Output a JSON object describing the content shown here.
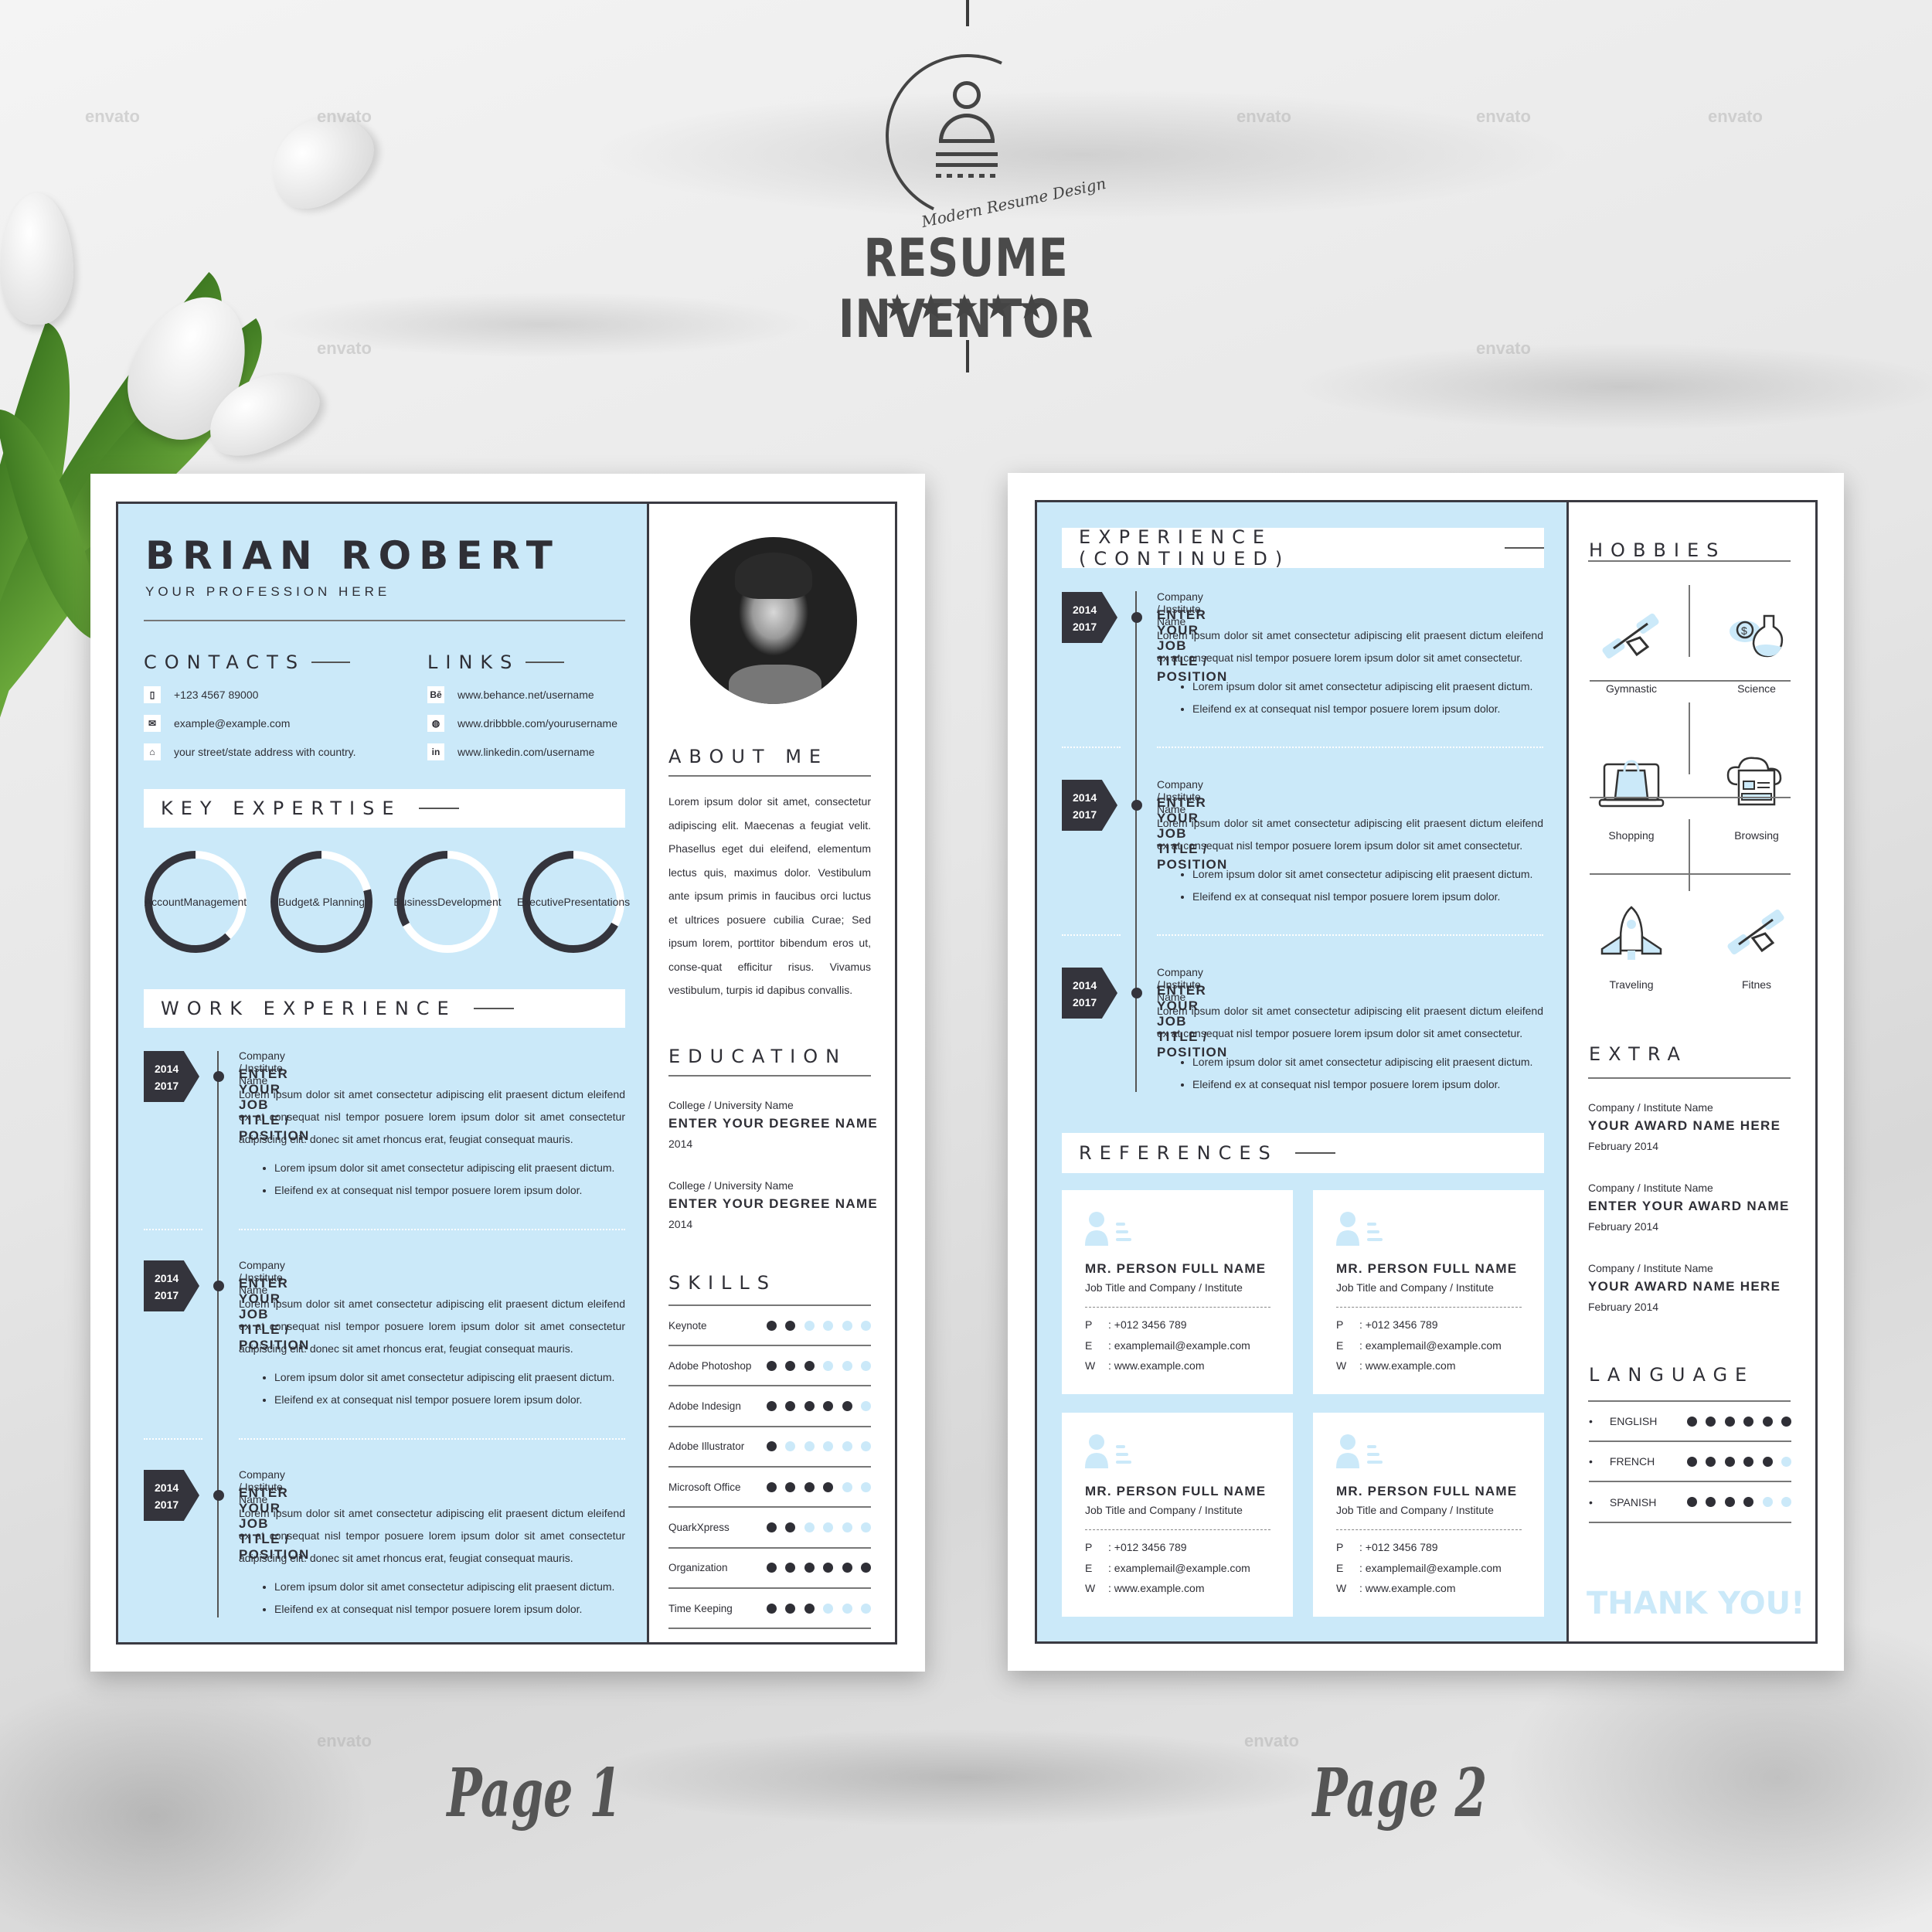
{
  "brand": {
    "logo_tagline": "Modern Resume Design",
    "title": "RESUME INVENTOR",
    "stars": "★★★★★",
    "rating": 5,
    "watermark": "envato"
  },
  "captions": {
    "page1": "Page 1",
    "page2": "Page 2"
  },
  "colors": {
    "accent": "#cbe9f9",
    "dark": "#34343c",
    "text": "#2f2f36"
  },
  "page1": {
    "name": "BRIAN ROBERT",
    "profession": "YOUR PROFESSION HERE",
    "contacts": {
      "heading": "CONTACTS",
      "items": [
        {
          "icon": "phone-icon",
          "glyph": "▯",
          "text": "+123 4567 89000"
        },
        {
          "icon": "envelope-icon",
          "glyph": "✉",
          "text": "example@example.com"
        },
        {
          "icon": "home-icon",
          "glyph": "⌂",
          "text": "your street/state address with country."
        }
      ]
    },
    "links": {
      "heading": "LINKS",
      "items": [
        {
          "icon": "behance-icon",
          "glyph": "Bē",
          "text": "www.behance.net/username"
        },
        {
          "icon": "dribbble-icon",
          "glyph": "◍",
          "text": "www.dribbble.com/yourusername"
        },
        {
          "icon": "linkedin-icon",
          "glyph": "in",
          "text": "www.linkedin.com/username"
        }
      ]
    },
    "key_expertise": {
      "heading": "KEY EXPERTISE",
      "items": [
        {
          "line1": "Account",
          "line2": "Management",
          "percent": 62
        },
        {
          "line1": "Budget",
          "line2": "& Planning",
          "percent": 79
        },
        {
          "line1": "Business",
          "line2": "Development",
          "percent": 33
        },
        {
          "line1": "Executive",
          "line2": "Presentations",
          "percent": 67
        }
      ]
    },
    "work_experience": {
      "heading": "WORK EXPERIENCE",
      "jobs": [
        {
          "start": "2014",
          "end": "2017",
          "company": "Company / Institute Name",
          "title": "ENTER YOUR JOB TITLE / POSITION",
          "description": "Lorem ipsum dolor sit amet consectetur adipiscing elit praesent dictum eleifend ex at consequat nisl tempor posuere lorem ipsum dolor sit amet consectetur adipiscing elit. donec sit amet rhoncus erat, feugiat consequat mauris.",
          "bullets": [
            "Lorem ipsum dolor sit amet consectetur adipiscing elit praesent dictum.",
            "Eleifend ex at consequat nisl tempor posuere lorem ipsum dolor."
          ]
        },
        {
          "start": "2014",
          "end": "2017",
          "company": "Company / Institute Name",
          "title": "ENTER YOUR JOB TITLE / POSITION",
          "description": "Lorem ipsum dolor sit amet consectetur adipiscing elit praesent dictum eleifend ex at consequat nisl tempor posuere lorem ipsum dolor sit amet consectetur adipiscing elit. donec sit amet rhoncus erat, feugiat consequat mauris.",
          "bullets": [
            "Lorem ipsum dolor sit amet consectetur adipiscing elit praesent dictum.",
            "Eleifend ex at consequat nisl tempor posuere lorem ipsum dolor."
          ]
        },
        {
          "start": "2014",
          "end": "2017",
          "company": "Company / Institute Name",
          "title": "ENTER YOUR JOB TITLE / POSITION",
          "description": "Lorem ipsum dolor sit amet consectetur adipiscing elit praesent dictum eleifend ex at consequat nisl tempor posuere lorem ipsum dolor sit amet consectetur adipiscing elit. donec sit amet rhoncus erat, feugiat consequat mauris.",
          "bullets": [
            "Lorem ipsum dolor sit amet consectetur adipiscing elit praesent dictum.",
            "Eleifend ex at consequat nisl tempor posuere lorem ipsum dolor."
          ]
        }
      ]
    },
    "about": {
      "heading": "ABOUT ME",
      "text": "Lorem ipsum dolor sit amet, consectetur adipiscing elit. Maecenas a feugiat velit. Phasellus eget dui eleifend, elementum lectus quis, maximus dolor. Vestibulum ante ipsum primis in faucibus orci luctus et ultrices posuere cubilia Curae; Sed ipsum lorem, porttitor bibendum eros ut, conse-quat efficitur risus. Vivamus vestibulum, turpis id dapibus convallis."
    },
    "education": {
      "heading": "EDUCATION",
      "items": [
        {
          "college": "College / University Name",
          "degree": "ENTER YOUR DEGREE NAME",
          "year": "2014"
        },
        {
          "college": "College / University Name",
          "degree": "ENTER YOUR DEGREE NAME",
          "year": "2014"
        }
      ]
    },
    "skills": {
      "heading": "SKILLS",
      "max": 6,
      "items": [
        {
          "name": "Keynote",
          "level": 2
        },
        {
          "name": "Adobe Photoshop",
          "level": 3
        },
        {
          "name": "Adobe Indesign",
          "level": 5
        },
        {
          "name": "Adobe Illustrator",
          "level": 1
        },
        {
          "name": "Microsoft Office",
          "level": 4
        },
        {
          "name": "QuarkXpress",
          "level": 2
        },
        {
          "name": "Organization",
          "level": 6
        },
        {
          "name": "Time Keeping",
          "level": 3
        }
      ]
    }
  },
  "page2": {
    "experience": {
      "heading": "EXPERIENCE (CONTINUED)",
      "jobs": [
        {
          "start": "2014",
          "end": "2017",
          "company": "Company / Institute Name",
          "title": "ENTER YOUR JOB TITLE / POSITION",
          "description": "Lorem ipsum dolor sit amet consectetur adipiscing elit praesent dictum eleifend ex at consequat nisl tempor posuere lorem ipsum dolor sit amet consectetur.",
          "bullets": [
            "Lorem ipsum dolor sit amet consectetur adipiscing elit praesent dictum.",
            "Eleifend ex at consequat nisl tempor posuere lorem ipsum dolor."
          ]
        },
        {
          "start": "2014",
          "end": "2017",
          "company": "Company / Institute Name",
          "title": "ENTER YOUR JOB TITLE / POSITION",
          "description": "Lorem ipsum dolor sit amet consectetur adipiscing elit praesent dictum eleifend ex at consequat nisl tempor posuere lorem ipsum dolor sit amet consectetur.",
          "bullets": [
            "Lorem ipsum dolor sit amet consectetur adipiscing elit praesent dictum.",
            "Eleifend ex at consequat nisl tempor posuere lorem ipsum dolor."
          ]
        },
        {
          "start": "2014",
          "end": "2017",
          "company": "Company / Institute Name",
          "title": "ENTER YOUR JOB TITLE / POSITION",
          "description": "Lorem ipsum dolor sit amet consectetur adipiscing elit praesent dictum eleifend ex at consequat nisl tempor posuere lorem ipsum dolor sit amet consectetur.",
          "bullets": [
            "Lorem ipsum dolor sit amet consectetur adipiscing elit praesent dictum.",
            "Eleifend ex at consequat nisl tempor posuere lorem ipsum dolor."
          ]
        }
      ]
    },
    "references": {
      "heading": "REFERENCES",
      "items": [
        {
          "name": "MR. PERSON FULL NAME",
          "job": "Job Title and Company / Institute",
          "p_label": "P",
          "phone": "+012 3456 789",
          "e_label": "E",
          "email": "examplemail@example.com",
          "w_label": "W",
          "web": "www.example.com"
        },
        {
          "name": "MR. PERSON FULL NAME",
          "job": "Job Title and Company / Institute",
          "p_label": "P",
          "phone": "+012 3456 789",
          "e_label": "E",
          "email": "examplemail@example.com",
          "w_label": "W",
          "web": "www.example.com"
        },
        {
          "name": "MR. PERSON FULL NAME",
          "job": "Job Title and Company / Institute",
          "p_label": "P",
          "phone": "+012 3456 789",
          "e_label": "E",
          "email": "examplemail@example.com",
          "w_label": "W",
          "web": "www.example.com"
        },
        {
          "name": "MR. PERSON FULL NAME",
          "job": "Job Title and Company / Institute",
          "p_label": "P",
          "phone": "+012 3456 789",
          "e_label": "E",
          "email": "examplemail@example.com",
          "w_label": "W",
          "web": "www.example.com"
        }
      ]
    },
    "hobbies": {
      "heading": "HOBBIES",
      "items": [
        {
          "label": "Gymnastic",
          "icon": "dumbbell-icon"
        },
        {
          "label": "Science",
          "icon": "flask-icon"
        },
        {
          "label": "Shopping",
          "icon": "shopping-bag-icon"
        },
        {
          "label": "Browsing",
          "icon": "cloud-browser-icon"
        },
        {
          "label": "Traveling",
          "icon": "rocket-icon"
        },
        {
          "label": "Fitnes",
          "icon": "dumbbell-icon"
        }
      ]
    },
    "extra": {
      "heading": "EXTRA",
      "items": [
        {
          "company": "Company / Institute Name",
          "award": "YOUR AWARD NAME HERE",
          "date": "February 2014"
        },
        {
          "company": "Company / Institute Name",
          "award": "ENTER YOUR AWARD NAME",
          "date": "February 2014"
        },
        {
          "company": "Company / Institute Name",
          "award": "YOUR AWARD NAME HERE",
          "date": "February 2014"
        }
      ]
    },
    "language": {
      "heading": "LANGUAGE",
      "max": 6,
      "items": [
        {
          "name": "ENGLISH",
          "level": 6
        },
        {
          "name": "FRENCH",
          "level": 5
        },
        {
          "name": "SPANISH",
          "level": 4
        }
      ]
    },
    "thank_you": "THANK YOU!"
  }
}
